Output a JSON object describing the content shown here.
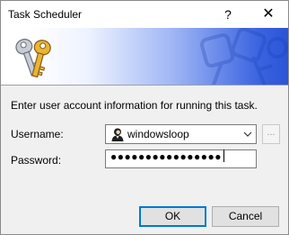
{
  "window": {
    "title": "Task Scheduler",
    "help_label": "?",
    "close_label": "✕"
  },
  "banner": {
    "icon": "keys-icon"
  },
  "form": {
    "instruction": "Enter user account information for running this task.",
    "username_label": "Username:",
    "username_value": "windowsloop",
    "username_icon": "user-icon",
    "browse_label": "...",
    "password_label": "Password:",
    "password_value": "●●●●●●●●●●●●●●●●"
  },
  "buttons": {
    "ok_label": "OK",
    "cancel_label": "Cancel"
  },
  "colors": {
    "accent": "#0078d7",
    "banner_blue": "#2b54d8"
  }
}
